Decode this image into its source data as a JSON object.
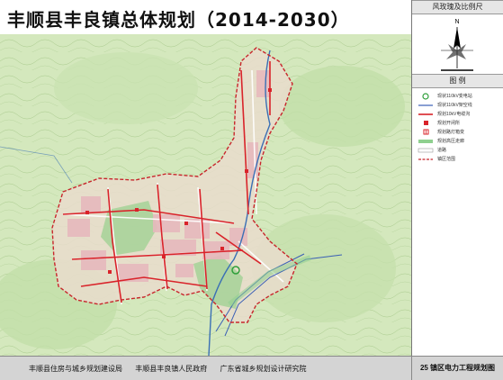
{
  "title": "丰顺县丰良镇总体规划（2014-2030）",
  "sidebar": {
    "compass_header": "风玫瑰及比例尺",
    "compass_north": "N",
    "legend_header": "图    例",
    "legend": [
      {
        "label": "现状110kV变电站",
        "icon": "substation-existing-icon",
        "color": "#2e9f3a"
      },
      {
        "label": "现状110kV架空线",
        "icon": "existing-110kv-line-icon",
        "color": "#3a5fb5"
      },
      {
        "label": "规划10kV电缆沟",
        "icon": "planned-10kv-cable-icon",
        "color": "#d9232a"
      },
      {
        "label": "规划开闭所",
        "icon": "switching-station-icon",
        "color": "#d9232a"
      },
      {
        "label": "规划路灯箱变",
        "icon": "streetlight-transformer-icon",
        "color": "#d9232a"
      },
      {
        "label": "规划高压走廊",
        "icon": "hv-corridor-icon",
        "color": "#8fd08f"
      },
      {
        "label": "道路",
        "icon": "road-icon",
        "color": "#999999"
      },
      {
        "label": "镇区范围",
        "icon": "town-boundary-icon",
        "color": "#c8262c"
      }
    ]
  },
  "footer": {
    "orgs": [
      "丰顺县住房与城乡规划建设局",
      "丰顺县丰良镇人民政府",
      "广东省城乡规划设计研究院"
    ],
    "sheet": "25 镇区电力工程规划图"
  },
  "colors": {
    "terrain": "#cfe5b4",
    "forest": "#b9dca6",
    "urban": "#e8b9bd",
    "boundary": "#c8262c",
    "river": "#3a6fb5"
  }
}
